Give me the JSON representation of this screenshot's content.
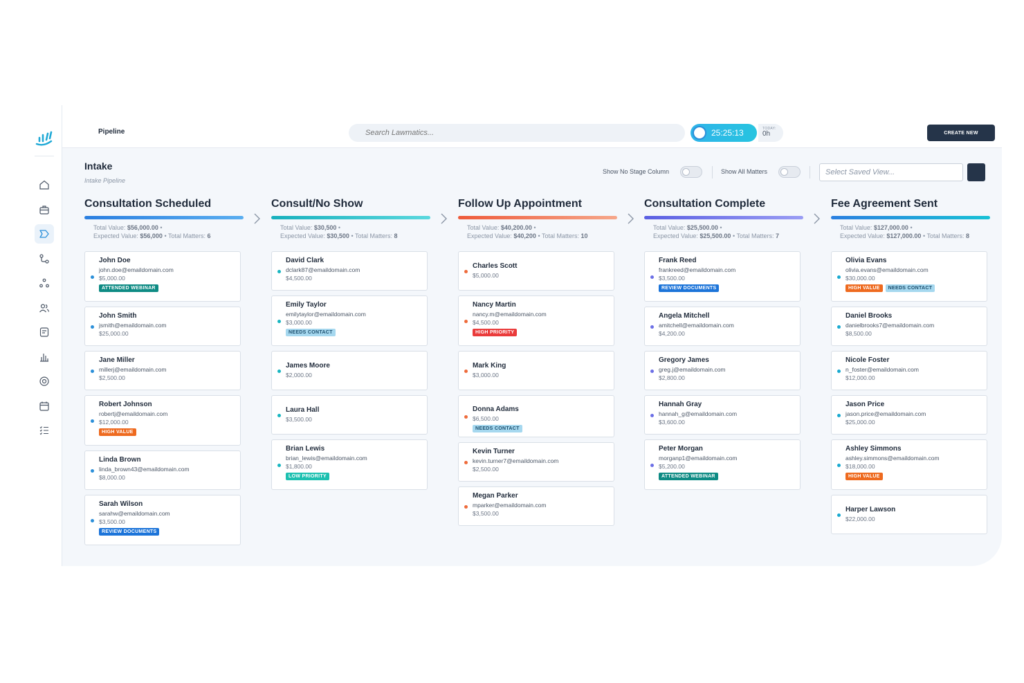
{
  "header": {
    "page_label": "Pipeline",
    "search_placeholder": "Search Lawmatics...",
    "timer": "25:25:13",
    "today_label": "TODAY:",
    "today_value": "0h",
    "create_label": "CREATE NEW"
  },
  "sidebar": {
    "items": [
      "home-icon",
      "briefcase-icon",
      "pipeline-icon",
      "workflow-icon",
      "network-icon",
      "contacts-icon",
      "document-icon",
      "reports-icon",
      "billing-icon",
      "calendar-icon",
      "tasks-icon"
    ]
  },
  "toolbar": {
    "title": "Intake",
    "subtitle": "Intake Pipeline",
    "toggle_no_stage": "Show No Stage Column",
    "toggle_all_matters": "Show All Matters",
    "saved_view_placeholder": "Select Saved View..."
  },
  "colors": {
    "accent_blue": "#2b8fd9",
    "teal": "#18b6c1",
    "orange": "#ee6a3a",
    "purple": "#6c6fe6",
    "navy": "#253449"
  },
  "columns": [
    {
      "title": "Consultation Scheduled",
      "total_label": "Total Value:",
      "total": "$56,000.00",
      "expected_label": "Expected Value:",
      "expected": "$56,000",
      "matters_label": "Total Matters:",
      "matters": "6",
      "cards": [
        {
          "name": "John Doe",
          "email": "john.doe@emaildomain.com",
          "value": "$5,000.00",
          "tags": [
            "ATTENDED WEBINAR"
          ]
        },
        {
          "name": "John Smith",
          "email": "jsmith@emaildomain.com",
          "value": "$25,000.00",
          "tags": []
        },
        {
          "name": "Jane Miller",
          "email": "millerj@emaildomain.com",
          "value": "$2,500.00",
          "tags": []
        },
        {
          "name": "Robert Johnson",
          "email": "robertj@emaildomain.com",
          "value": "$12,000.00",
          "tags": [
            "HIGH VALUE"
          ]
        },
        {
          "name": "Linda Brown",
          "email": "linda_brown43@emaildomain.com",
          "value": "$8,000.00",
          "tags": []
        },
        {
          "name": "Sarah Wilson",
          "email": "sarahw@emaildomain.com",
          "value": "$3,500.00",
          "tags": [
            "REVIEW DOCUMENTS"
          ]
        }
      ]
    },
    {
      "title": "Consult/No Show",
      "total_label": "Total Value:",
      "total": "$30,500",
      "expected_label": "Expected Value:",
      "expected": "$30,500",
      "matters_label": "Total Matters:",
      "matters": "8",
      "cards": [
        {
          "name": "David Clark",
          "email": "dclark87@emaildomain.com",
          "value": "$4,500.00",
          "tags": []
        },
        {
          "name": "Emily Taylor",
          "email": "emilytaylor@emaildomain.com",
          "value": "$3,000.00",
          "tags": [
            "NEEDS CONTACT"
          ]
        },
        {
          "name": "James Moore",
          "email": "",
          "value": "$2,000.00",
          "tags": []
        },
        {
          "name": "Laura Hall",
          "email": "",
          "value": "$3,500.00",
          "tags": []
        },
        {
          "name": "Brian Lewis",
          "email": "brian_lewis@emaildomain.com",
          "value": "$1,800.00",
          "tags": [
            "LOW PRIORITY"
          ]
        }
      ]
    },
    {
      "title": "Follow Up Appointment",
      "total_label": "Total Value:",
      "total": "$40,200.00",
      "expected_label": "Expected Value:",
      "expected": "$40,200",
      "matters_label": "Total Matters:",
      "matters": "10",
      "cards": [
        {
          "name": "Charles Scott",
          "email": "",
          "value": "$5,000.00",
          "tags": []
        },
        {
          "name": "Nancy Martin",
          "email": "nancy.m@emaildomain.com",
          "value": "$4,500.00",
          "tags": [
            "HIGH PRIORITY"
          ]
        },
        {
          "name": "Mark King",
          "email": "",
          "value": "$3,000.00",
          "tags": []
        },
        {
          "name": "Donna Adams",
          "email": "",
          "value": "$6,500.00",
          "tags": [
            "NEEDS CONTACT"
          ]
        },
        {
          "name": "Kevin Turner",
          "email": "kevin.turner7@emaildomain.com",
          "value": "$2,500.00",
          "tags": []
        },
        {
          "name": "Megan Parker",
          "email": "mparker@emaildomain.com",
          "value": "$3,500.00",
          "tags": []
        }
      ]
    },
    {
      "title": "Consultation Complete",
      "total_label": "Total Value:",
      "total": "$25,500.00",
      "expected_label": "Expected Value:",
      "expected": "$25,500.00",
      "matters_label": "Total Matters:",
      "matters": "7",
      "cards": [
        {
          "name": "Frank Reed",
          "email": "frankreed@emaildomain.com",
          "value": "$3,500.00",
          "tags": [
            "REVIEW DOCUMENTS"
          ]
        },
        {
          "name": "Angela Mitchell",
          "email": "amitchell@emaildomain.com",
          "value": "$4,200.00",
          "tags": []
        },
        {
          "name": "Gregory James",
          "email": "greg.j@emaildomain.com",
          "value": "$2,800.00",
          "tags": []
        },
        {
          "name": "Hannah Gray",
          "email": "hannah_g@emaildomain.com",
          "value": "$3,600.00",
          "tags": []
        },
        {
          "name": "Peter Morgan",
          "email": "morganp1@emaildomain.com",
          "value": "$5,200.00",
          "tags": [
            "ATTENDED WEBINAR"
          ]
        }
      ]
    },
    {
      "title": "Fee Agreement Sent",
      "total_label": "Total Value:",
      "total": "$127,000.00",
      "expected_label": "Expected Value:",
      "expected": "$127,000.00",
      "matters_label": "Total Matters:",
      "matters": "8",
      "cards": [
        {
          "name": "Olivia Evans",
          "email": "olivia.evans@emaildomain.com",
          "value": "$30,000.00",
          "tags": [
            "HIGH VALUE",
            "NEEDS CONTACT"
          ]
        },
        {
          "name": "Daniel Brooks",
          "email": "danielbrooks7@emaildomain.com",
          "value": "$8,500.00",
          "tags": []
        },
        {
          "name": "Nicole Foster",
          "email": "n_foster@emaildomain.com",
          "value": "$12,000.00",
          "tags": []
        },
        {
          "name": "Jason Price",
          "email": "jason.price@emaildomain.com",
          "value": "$25,000.00",
          "tags": []
        },
        {
          "name": "Ashley Simmons",
          "email": "ashley.simmons@emaildomain.com",
          "value": "$18,000.00",
          "tags": [
            "HIGH VALUE"
          ]
        },
        {
          "name": "Harper Lawson",
          "email": "",
          "value": "$22,000.00",
          "tags": []
        }
      ]
    }
  ]
}
